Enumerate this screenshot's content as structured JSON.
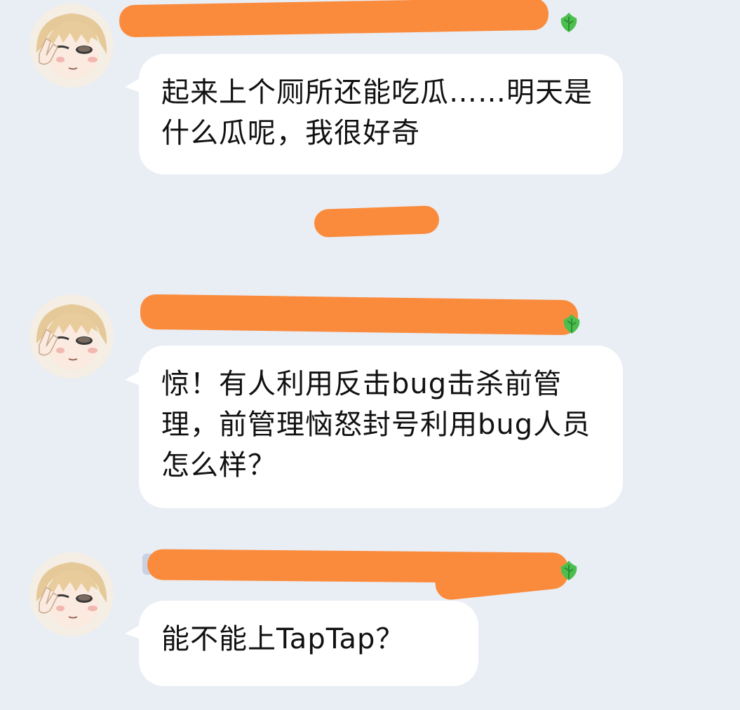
{
  "messages": [
    {
      "text": "起来上个厕所还能吃瓜……明天是什么瓜呢，我很好奇",
      "sender_name_redacted": true,
      "avatar_icon": "anime-avatar-icon",
      "badge_icon": "green-leaf-icon"
    },
    {
      "text": "惊！有人利用反击bug击杀前管理，前管理恼怒封号利用bug人员怎么样？",
      "sender_name_redacted": true,
      "avatar_icon": "anime-avatar-icon",
      "badge_icon": "green-leaf-icon"
    },
    {
      "text": "能不能上TapTap？",
      "sender_name_redacted": true,
      "avatar_icon": "anime-avatar-icon",
      "badge_icon": "green-leaf-icon"
    }
  ],
  "timestamp": {
    "text": "",
    "redacted": true
  },
  "colors": {
    "background": "#e9edf4",
    "bubble": "#ffffff",
    "redaction": "#fb8b3c",
    "text": "#111111"
  }
}
